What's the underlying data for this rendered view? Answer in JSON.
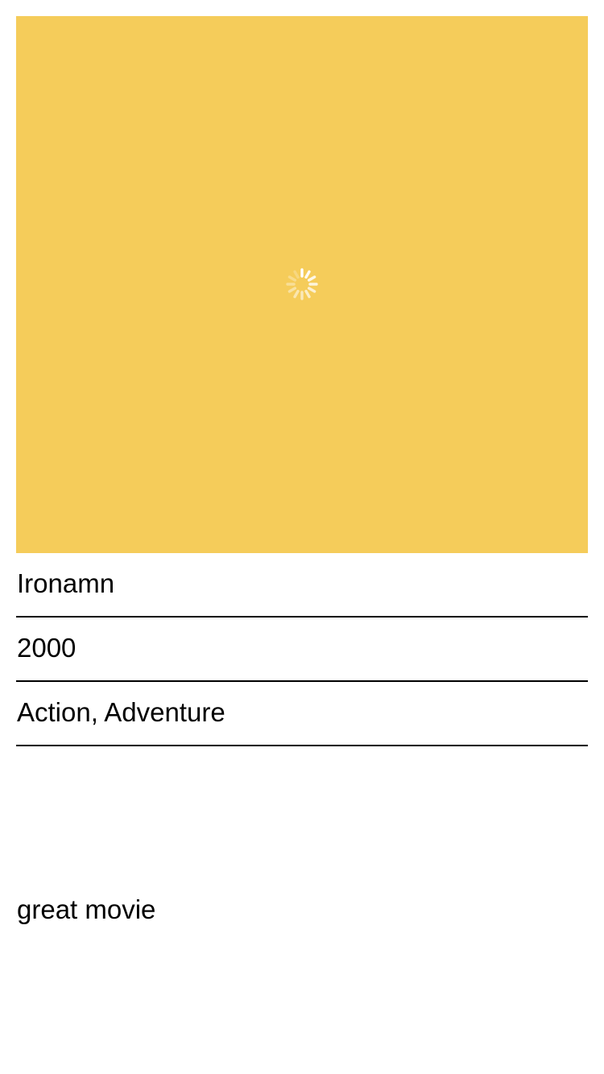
{
  "poster": {
    "background_color": "#f5cc5a",
    "loading_icon": "activity-spinner-icon"
  },
  "movie": {
    "title": "Ironamn",
    "year": "2000",
    "genre": "Action, Adventure",
    "review": "great movie"
  }
}
